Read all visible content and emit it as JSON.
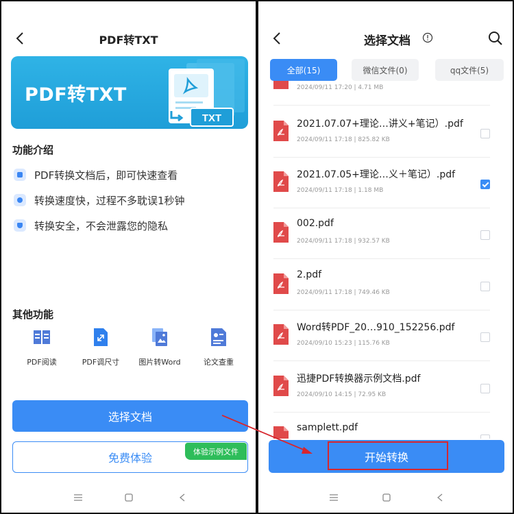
{
  "left": {
    "header": {
      "title": "PDF转TXT"
    },
    "banner": {
      "title": "PDF转TXT",
      "tag": "TXT"
    },
    "features": {
      "title": "功能介绍",
      "items": [
        {
          "label": "PDF转换文档后，即可快速查看"
        },
        {
          "label": "转换速度快，过程不多耽误1秒钟"
        },
        {
          "label": "转换安全，不会泄露您的隐私"
        }
      ]
    },
    "other": {
      "title": "其他功能",
      "items": [
        {
          "label": "PDF阅读",
          "icon": "book-icon"
        },
        {
          "label": "PDF调尺寸",
          "icon": "resize-icon"
        },
        {
          "label": "图片转Word",
          "icon": "image-to-word-icon"
        },
        {
          "label": "论文查重",
          "icon": "id-card-icon"
        }
      ]
    },
    "buttons": {
      "select": "选择文档",
      "trial": "免费体验",
      "sample_badge": "体验示例文件"
    }
  },
  "right": {
    "header": {
      "title": "选择文档"
    },
    "tabs": [
      {
        "label": "全部(15)",
        "active": true
      },
      {
        "label": "微信文件(0)",
        "active": false
      },
      {
        "label": "qq文件(5)",
        "active": false
      }
    ],
    "files": [
      {
        "name": "",
        "meta": "2024/09/11 17:20 | 4.71 MB",
        "checked": false
      },
      {
        "name": "2021.07.07+理论…讲义+笔记）.pdf",
        "meta": "2024/09/11 17:18 | 825.82 KB",
        "checked": false
      },
      {
        "name": "2021.07.05+理论…义＋笔记）.pdf",
        "meta": "2024/09/11 17:18 | 1.18 MB",
        "checked": true
      },
      {
        "name": "002.pdf",
        "meta": "2024/09/11 17:18 | 932.57 KB",
        "checked": false
      },
      {
        "name": "2.pdf",
        "meta": "2024/09/11 17:18 | 749.46 KB",
        "checked": false
      },
      {
        "name": "Word转PDF_20…910_152256.pdf",
        "meta": "2024/09/10 15:23 | 115.76 KB",
        "checked": false
      },
      {
        "name": "迅捷PDF转换器示例文档.pdf",
        "meta": "2024/09/10 14:15 | 72.95 KB",
        "checked": false
      },
      {
        "name": "samplett.pdf",
        "meta": "",
        "checked": false
      }
    ],
    "start_button": "开始转换"
  },
  "colors": {
    "accent": "#3a8cf5",
    "banner": "#1f9ed8",
    "badge": "#2ebd5a",
    "annotation": "#d7262e",
    "pdf_red": "#e04a4a"
  }
}
